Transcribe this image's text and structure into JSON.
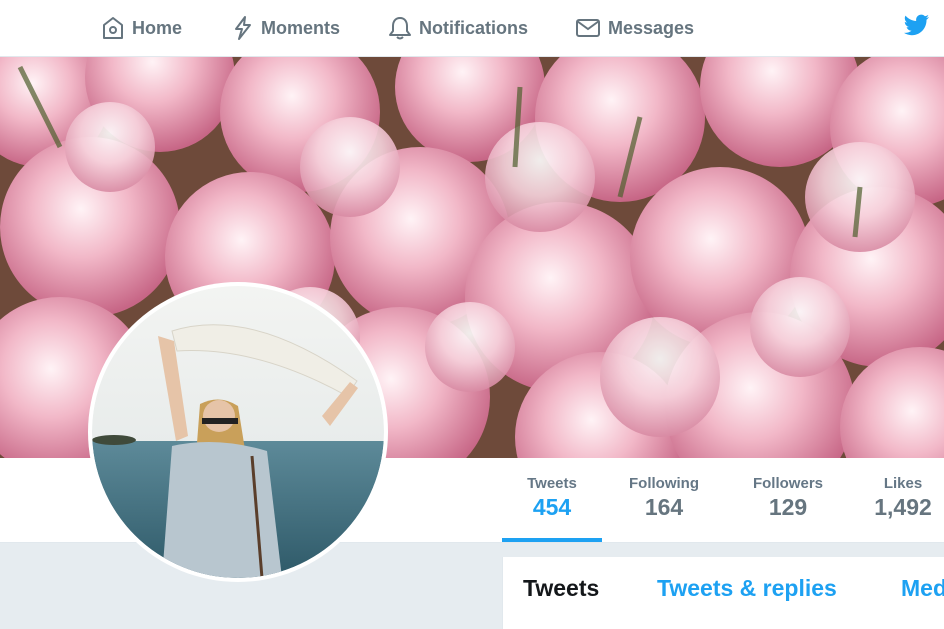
{
  "nav": {
    "items": [
      {
        "label": "Home",
        "icon": "home-icon"
      },
      {
        "label": "Moments",
        "icon": "lightning-icon"
      },
      {
        "label": "Notifications",
        "icon": "bell-icon"
      },
      {
        "label": "Messages",
        "icon": "envelope-icon"
      }
    ],
    "brand_icon": "twitter-bird-icon"
  },
  "banner": {
    "image": "pink peony flowers"
  },
  "avatar": {
    "image": "woman holding white scarf by the sea"
  },
  "stats": [
    {
      "label": "Tweets",
      "value": "454"
    },
    {
      "label": "Following",
      "value": "164"
    },
    {
      "label": "Followers",
      "value": "129"
    },
    {
      "label": "Likes",
      "value": "1,492"
    }
  ],
  "timeline": {
    "tabs": [
      {
        "label": "Tweets"
      },
      {
        "label": "Tweets & replies"
      },
      {
        "label": "Media"
      }
    ]
  },
  "colors": {
    "accent": "#1da1f2",
    "muted": "#66757f",
    "page_bg": "#e6ecf0"
  }
}
